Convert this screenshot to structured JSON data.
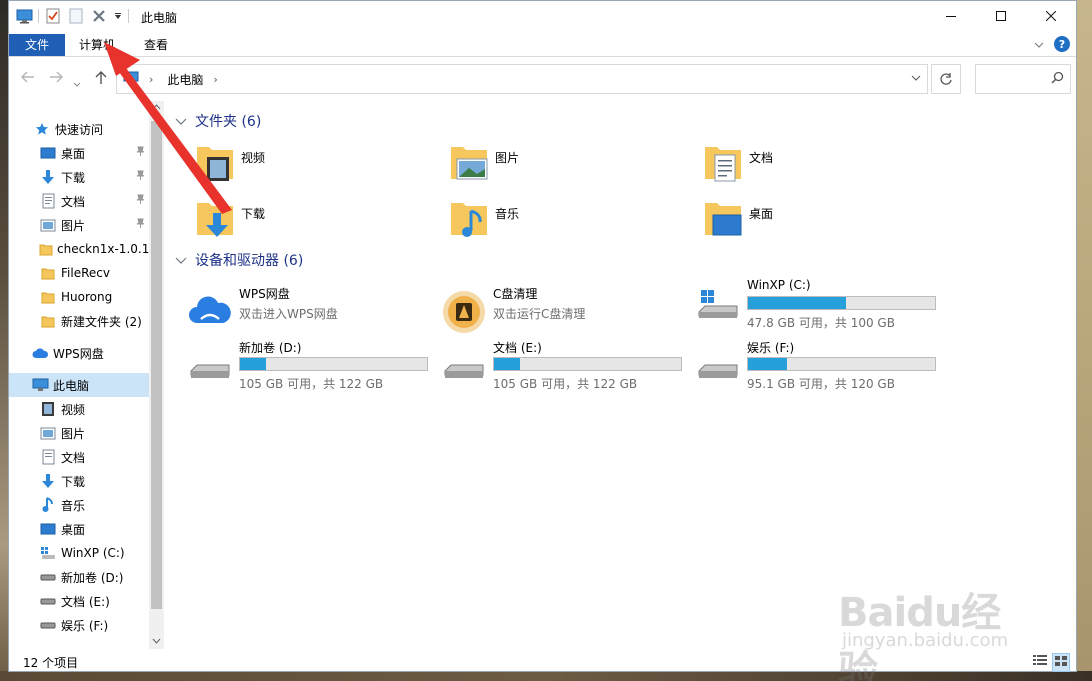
{
  "window": {
    "title": "此电脑"
  },
  "ribbon": {
    "tabs": [
      {
        "label": "文件"
      },
      {
        "label": "计算机"
      },
      {
        "label": "查看"
      }
    ]
  },
  "address": {
    "crumb": "此电脑",
    "separator": "›"
  },
  "nav": {
    "quick_access": "快速访问",
    "items": [
      {
        "label": "桌面",
        "icon": "desktop-icon",
        "pinned": true
      },
      {
        "label": "下载",
        "icon": "download-icon",
        "pinned": true
      },
      {
        "label": "文档",
        "icon": "document-icon",
        "pinned": true
      },
      {
        "label": "图片",
        "icon": "picture-icon",
        "pinned": true
      },
      {
        "label": "checkn1x-1.0.1",
        "icon": "folder-icon"
      },
      {
        "label": "FileRecv",
        "icon": "folder-icon"
      },
      {
        "label": "Huorong",
        "icon": "folder-icon"
      },
      {
        "label": "新建文件夹 (2)",
        "icon": "folder-icon"
      }
    ],
    "wps": "WPS网盘",
    "this_pc": "此电脑",
    "pc_items": [
      {
        "label": "视频",
        "icon": "video-icon"
      },
      {
        "label": "图片",
        "icon": "picture-icon"
      },
      {
        "label": "文档",
        "icon": "document-icon"
      },
      {
        "label": "下载",
        "icon": "download-icon"
      },
      {
        "label": "音乐",
        "icon": "music-icon"
      },
      {
        "label": "桌面",
        "icon": "desktop-icon"
      },
      {
        "label": "WinXP (C:)",
        "icon": "windows-drive-icon"
      },
      {
        "label": "新加卷 (D:)",
        "icon": "drive-icon"
      },
      {
        "label": "文档 (E:)",
        "icon": "drive-icon"
      },
      {
        "label": "娱乐 (F:)",
        "icon": "drive-icon"
      }
    ]
  },
  "folders": {
    "header": "文件夹 (6)",
    "items": [
      {
        "label": "视频"
      },
      {
        "label": "图片"
      },
      {
        "label": "文档"
      },
      {
        "label": "下载"
      },
      {
        "label": "音乐"
      },
      {
        "label": "桌面"
      }
    ]
  },
  "devices": {
    "header": "设备和驱动器 (6)",
    "wps": {
      "name": "WPS网盘",
      "sub": "双击进入WPS网盘"
    },
    "cclean": {
      "name": "C盘清理",
      "sub": "双击运行C盘清理"
    },
    "drives": [
      {
        "name": "WinXP (C:)",
        "free": "47.8 GB 可用，共 100 GB",
        "used_fraction": 0.522
      },
      {
        "name": "新加卷 (D:)",
        "free": "105 GB 可用，共 122 GB",
        "used_fraction": 0.139
      },
      {
        "name": "文档 (E:)",
        "free": "105 GB 可用，共 122 GB",
        "used_fraction": 0.139
      },
      {
        "name": "娱乐 (F:)",
        "free": "95.1 GB 可用，共 120 GB",
        "used_fraction": 0.208
      }
    ]
  },
  "status": {
    "count": "12 个项目"
  },
  "watermark": {
    "logo": "Baidu经验",
    "url": "jingyan.baidu.com"
  },
  "colors": {
    "accent": "#1f5fb5",
    "bar": "#26a0da",
    "arrow": "#e8322c",
    "group": "#1e3287"
  }
}
